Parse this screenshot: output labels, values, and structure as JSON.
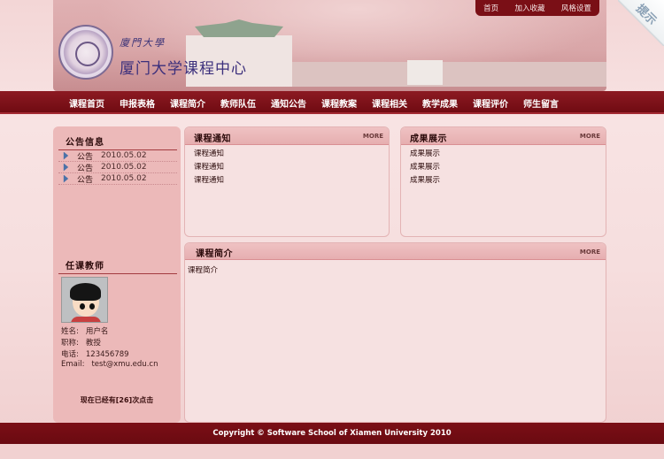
{
  "header": {
    "top_links": [
      "首页",
      "加入收藏",
      "风格设置"
    ],
    "logo_script": "廈門大學",
    "logo_title": "厦门大学课程中心"
  },
  "tip_label": "提示",
  "nav": [
    "课程首页",
    "申报表格",
    "课程简介",
    "教师队伍",
    "通知公告",
    "课程教案",
    "课程相关",
    "教学成果",
    "课程评价",
    "师生留言"
  ],
  "sidebar": {
    "notice_title": "公告信息",
    "notices": [
      {
        "label": "公告",
        "date": "2010.05.02"
      },
      {
        "label": "公告",
        "date": "2010.05.02"
      },
      {
        "label": "公告",
        "date": "2010.05.02"
      }
    ],
    "teacher_title": "任课教师",
    "teacher": {
      "name_key": "姓名:",
      "name": "用户名",
      "title_key": "职称:",
      "title": "教授",
      "phone_key": "电话:",
      "phone": "123456789",
      "email_key": "Email:",
      "email": "test@xmu.edu.cn"
    },
    "visits": "现在已经有[26]次点击"
  },
  "panels": {
    "course_notice": {
      "title": "课程通知",
      "more": "MORE",
      "items": [
        "课程通知",
        "课程通知",
        "课程通知"
      ]
    },
    "achievements": {
      "title": "成果展示",
      "more": "MORE",
      "items": [
        "成果展示",
        "成果展示",
        "成果展示"
      ]
    },
    "intro": {
      "title": "课程简介",
      "more": "MORE",
      "body": "课程简介"
    }
  },
  "footer": "Copyright © Software School of Xiamen University 2010",
  "colors": {
    "nav_bg": "#7a0f16",
    "panel_bg": "#f6e1e1",
    "sidebar_bg": "#ecb9b9"
  }
}
